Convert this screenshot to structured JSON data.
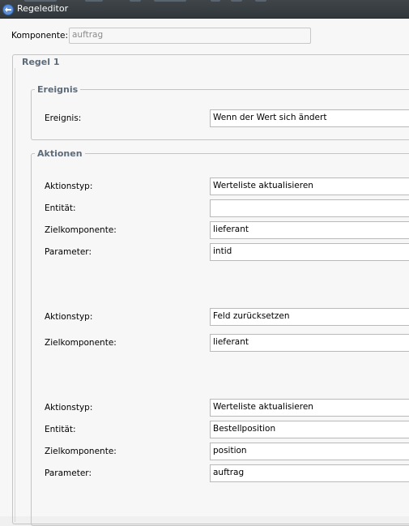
{
  "window": {
    "title": "Regeleditor"
  },
  "component": {
    "label": "Komponente:",
    "value": "auftrag"
  },
  "rule": {
    "title": "Regel 1"
  },
  "event_group": {
    "title": "Ereignis",
    "label": "Ereignis:",
    "value": "Wenn der Wert sich ändert"
  },
  "actions_group": {
    "title": "Aktionen",
    "actions": [
      {
        "type": {
          "label": "Aktionstyp:",
          "value": "Werteliste aktualisieren"
        },
        "entity": {
          "label": "Entität:",
          "value": ""
        },
        "target": {
          "label": "Zielkomponente:",
          "value": "lieferant"
        },
        "param": {
          "label": "Parameter:",
          "value": "intid"
        }
      },
      {
        "type": {
          "label": "Aktionstyp:",
          "value": "Feld zurücksetzen"
        },
        "target": {
          "label": "Zielkomponente:",
          "value": "lieferant"
        }
      },
      {
        "type": {
          "label": "Aktionstyp:",
          "value": "Werteliste aktualisieren"
        },
        "entity": {
          "label": "Entität:",
          "value": "Bestellposition"
        },
        "target": {
          "label": "Zielkomponente:",
          "value": "position"
        },
        "param": {
          "label": "Parameter:",
          "value": "auftrag"
        }
      }
    ]
  },
  "icons": {
    "app": "rule-editor-app-icon"
  },
  "colors": {
    "titlebar": "#3a3f43",
    "group_title": "#5e6b79",
    "background": "#f7f7f7"
  }
}
